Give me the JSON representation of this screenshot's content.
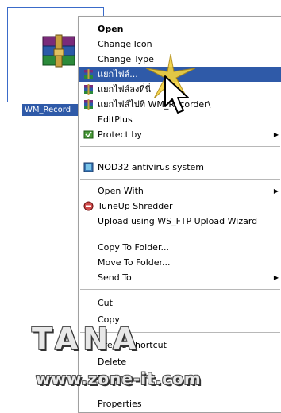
{
  "desktop": {
    "file_label": "WM_Record"
  },
  "menu": {
    "items": [
      {
        "label": "Open",
        "icon": null
      },
      {
        "label": "Change Icon",
        "icon": null
      },
      {
        "label": "Change Type",
        "icon": null
      },
      {
        "label": "แยกไฟล์...",
        "icon": "winrar-icon"
      },
      {
        "label": "แยกไฟล์ลงที่นี่",
        "icon": "winrar-icon"
      },
      {
        "label": "แยกไฟล์ไปที่ WM_Recorder\\",
        "icon": "winrar-icon"
      },
      {
        "label": "EditPlus",
        "icon": null
      },
      {
        "label": "Protect by",
        "icon": "protect-icon"
      },
      {
        "label": "NOD32 antivirus system",
        "icon": "nod32-icon"
      },
      {
        "label": "Open With",
        "icon": null
      },
      {
        "label": "TuneUp Shredder",
        "icon": "shredder-icon"
      },
      {
        "label": "Upload using WS_FTP Upload Wizard",
        "icon": null
      },
      {
        "label": "Copy To Folder...",
        "icon": null
      },
      {
        "label": "Move To Folder...",
        "icon": null
      },
      {
        "label": "Send To",
        "icon": null
      },
      {
        "label": "Cut",
        "icon": null
      },
      {
        "label": "Copy",
        "icon": null
      },
      {
        "label": "Create Shortcut",
        "icon": null
      },
      {
        "label": "Delete",
        "icon": null
      },
      {
        "label": "Rename",
        "icon": null
      },
      {
        "label": "Properties",
        "icon": null
      }
    ],
    "submenu_arrow": "▶",
    "highlight_color": "#2f5aa8"
  },
  "watermark": {
    "brand": "TANA",
    "url": "www.zone-it.com"
  }
}
